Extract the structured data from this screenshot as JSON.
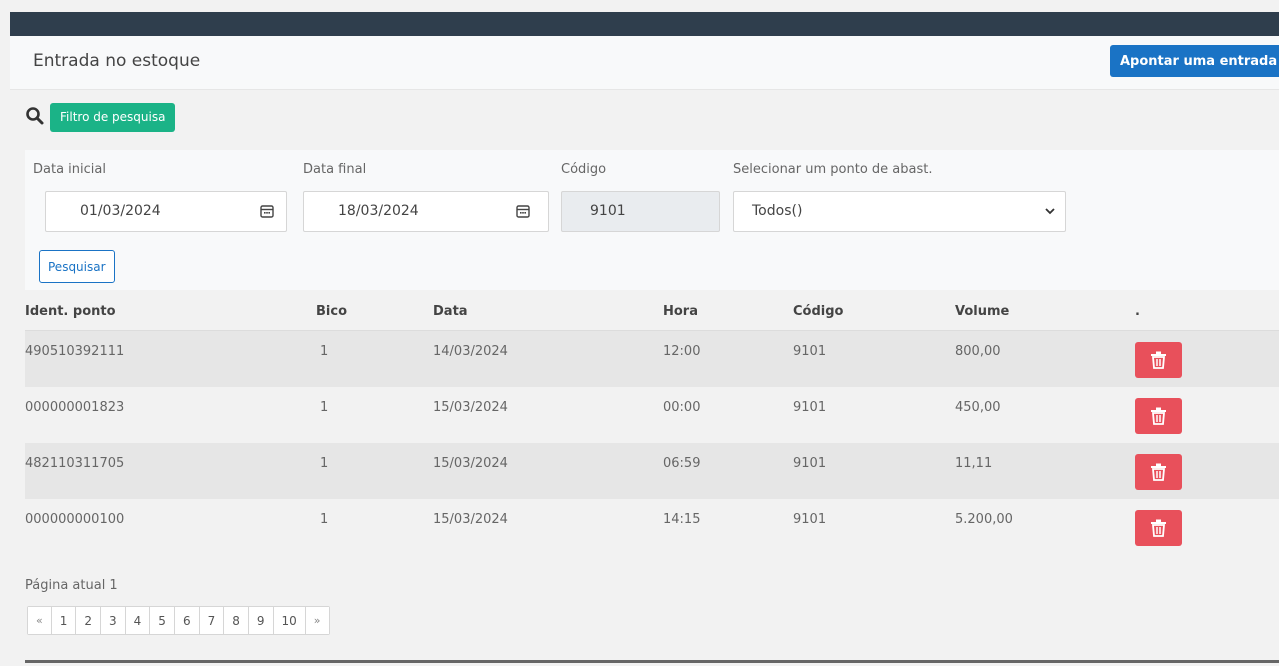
{
  "header": {
    "title": "Entrada no estoque",
    "add_button_label": "Apontar uma entrada"
  },
  "filter": {
    "badge_label": "Filtro de pesquisa",
    "data_inicial": {
      "label": "Data inicial",
      "value": "01/03/2024"
    },
    "data_final": {
      "label": "Data final",
      "value": "18/03/2024"
    },
    "codigo": {
      "label": "Código",
      "value": "9101"
    },
    "ponto": {
      "label": "Selecionar um ponto de abast.",
      "value": "Todos()"
    },
    "search_button_label": "Pesquisar"
  },
  "table": {
    "columns": [
      "Ident. ponto",
      "Bico",
      "Data",
      "Hora",
      "Código",
      "Volume",
      "."
    ],
    "rows": [
      [
        "490510392111",
        "1",
        "14/03/2024",
        "12:00",
        "9101",
        "800,00"
      ],
      [
        "000000001823",
        "1",
        "15/03/2024",
        "00:00",
        "9101",
        "450,00"
      ],
      [
        "482110311705",
        "1",
        "15/03/2024",
        "06:59",
        "9101",
        "11,11"
      ],
      [
        "000000000100",
        "1",
        "15/03/2024",
        "14:15",
        "9101",
        "5.200,00"
      ]
    ],
    "row_action_icon": "trash-icon",
    "row_action_color": "#e8505b"
  },
  "pagination": {
    "current_label": "Página atual 1",
    "prev": "«",
    "next": "»",
    "pages": [
      "1",
      "2",
      "3",
      "4",
      "5",
      "6",
      "7",
      "8",
      "9",
      "10"
    ]
  },
  "colors": {
    "topbar": "#2f3e4d",
    "primary": "#1a73c5",
    "filter_badge": "#1bb387",
    "danger": "#e8505b"
  }
}
